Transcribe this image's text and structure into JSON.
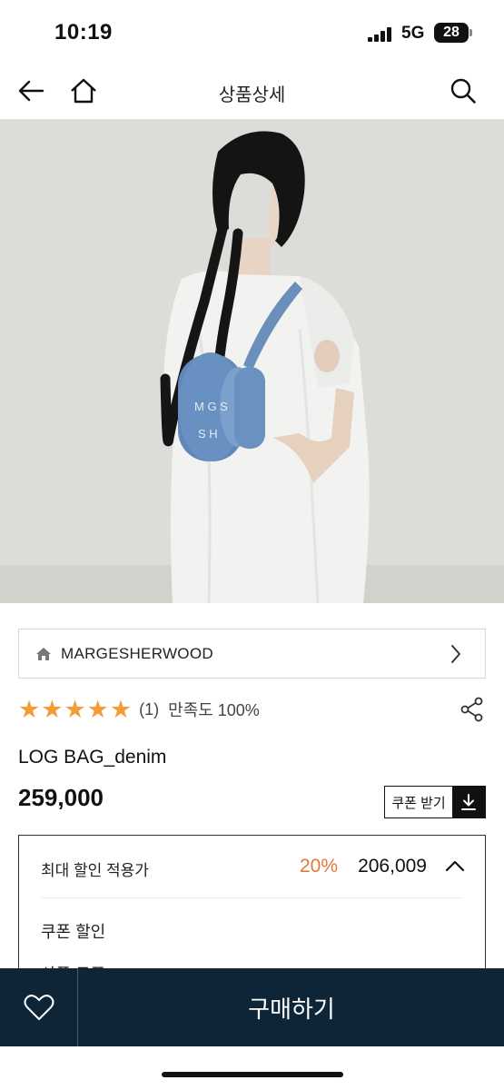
{
  "status_bar": {
    "time": "10:19",
    "network": "5G",
    "battery": "28"
  },
  "header": {
    "title": "상품상세"
  },
  "brand": {
    "name": "MARGESHERWOOD"
  },
  "rating": {
    "stars": 5,
    "count": "(1)",
    "satisfaction": "만족도 100%"
  },
  "product": {
    "name": "LOG BAG_denim",
    "price": "259,000"
  },
  "coupon_button": {
    "label": "쿠폰 받기"
  },
  "discount": {
    "title": "최대 할인 적용가",
    "rate": "20%",
    "price": "206,009",
    "items": [
      "쿠폰 할인",
      "상품 쿠폰"
    ]
  },
  "bottom_bar": {
    "buy_label": "구매하기"
  },
  "colors": {
    "star": "#f29d38",
    "discount_rate": "#e3763a",
    "bottom_bar": "#0d2536"
  }
}
